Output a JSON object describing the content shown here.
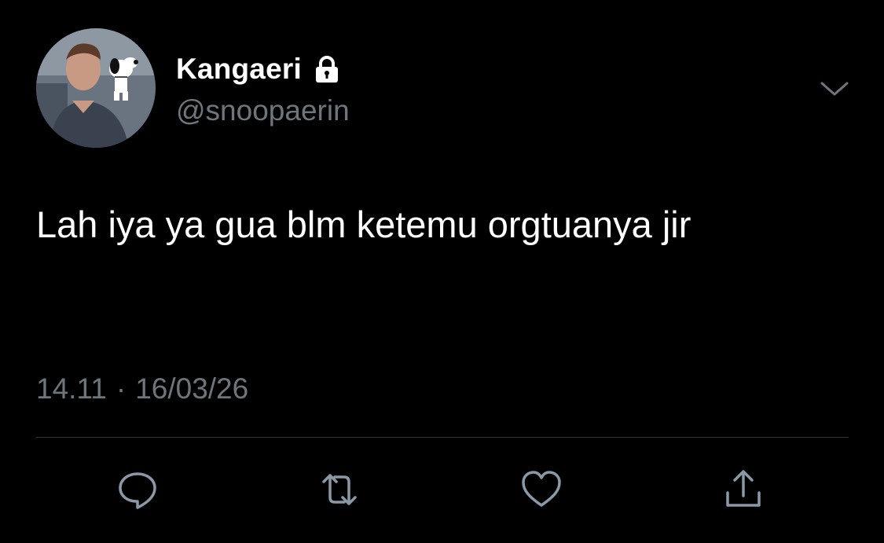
{
  "tweet": {
    "display_name": "Kangaeri",
    "handle": "@snoopaerin",
    "text": "Lah iya ya gua blm ketemu orgtuanya jir",
    "time": "14.11",
    "separator": "·",
    "date": "16/03/26"
  },
  "icons": {
    "lock": "lock-icon",
    "caret": "chevron-down-icon",
    "reply": "reply-icon",
    "retweet": "retweet-icon",
    "like": "heart-icon",
    "share": "share-icon"
  },
  "colors": {
    "background": "#000000",
    "text": "#ffffff",
    "muted": "#6e767d",
    "divider": "#2f3336",
    "icon": "#8b98a5"
  }
}
